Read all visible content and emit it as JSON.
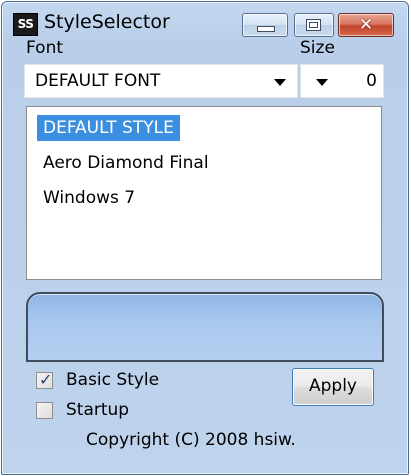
{
  "window": {
    "app_icon_text": "SS",
    "title": "StyleSelector",
    "close_glyph": "✕"
  },
  "font": {
    "label": "Font",
    "selected": "DEFAULT FONT"
  },
  "size": {
    "label": "Size",
    "value": "0"
  },
  "styles": {
    "items": [
      {
        "label": "DEFAULT STYLE",
        "selected": true
      },
      {
        "label": "Aero Diamond Final",
        "selected": false
      },
      {
        "label": "Windows 7",
        "selected": false
      }
    ]
  },
  "options": {
    "basic_style": {
      "label": "Basic Style",
      "checked": true
    },
    "startup": {
      "label": "Startup",
      "checked": false
    }
  },
  "apply_label": "Apply",
  "copyright": "Copyright (C) 2008 hsiw.",
  "colors": {
    "selection": "#3b8fe0",
    "preview_glass": "#a9c7ee",
    "close_button": "#c0452b"
  }
}
